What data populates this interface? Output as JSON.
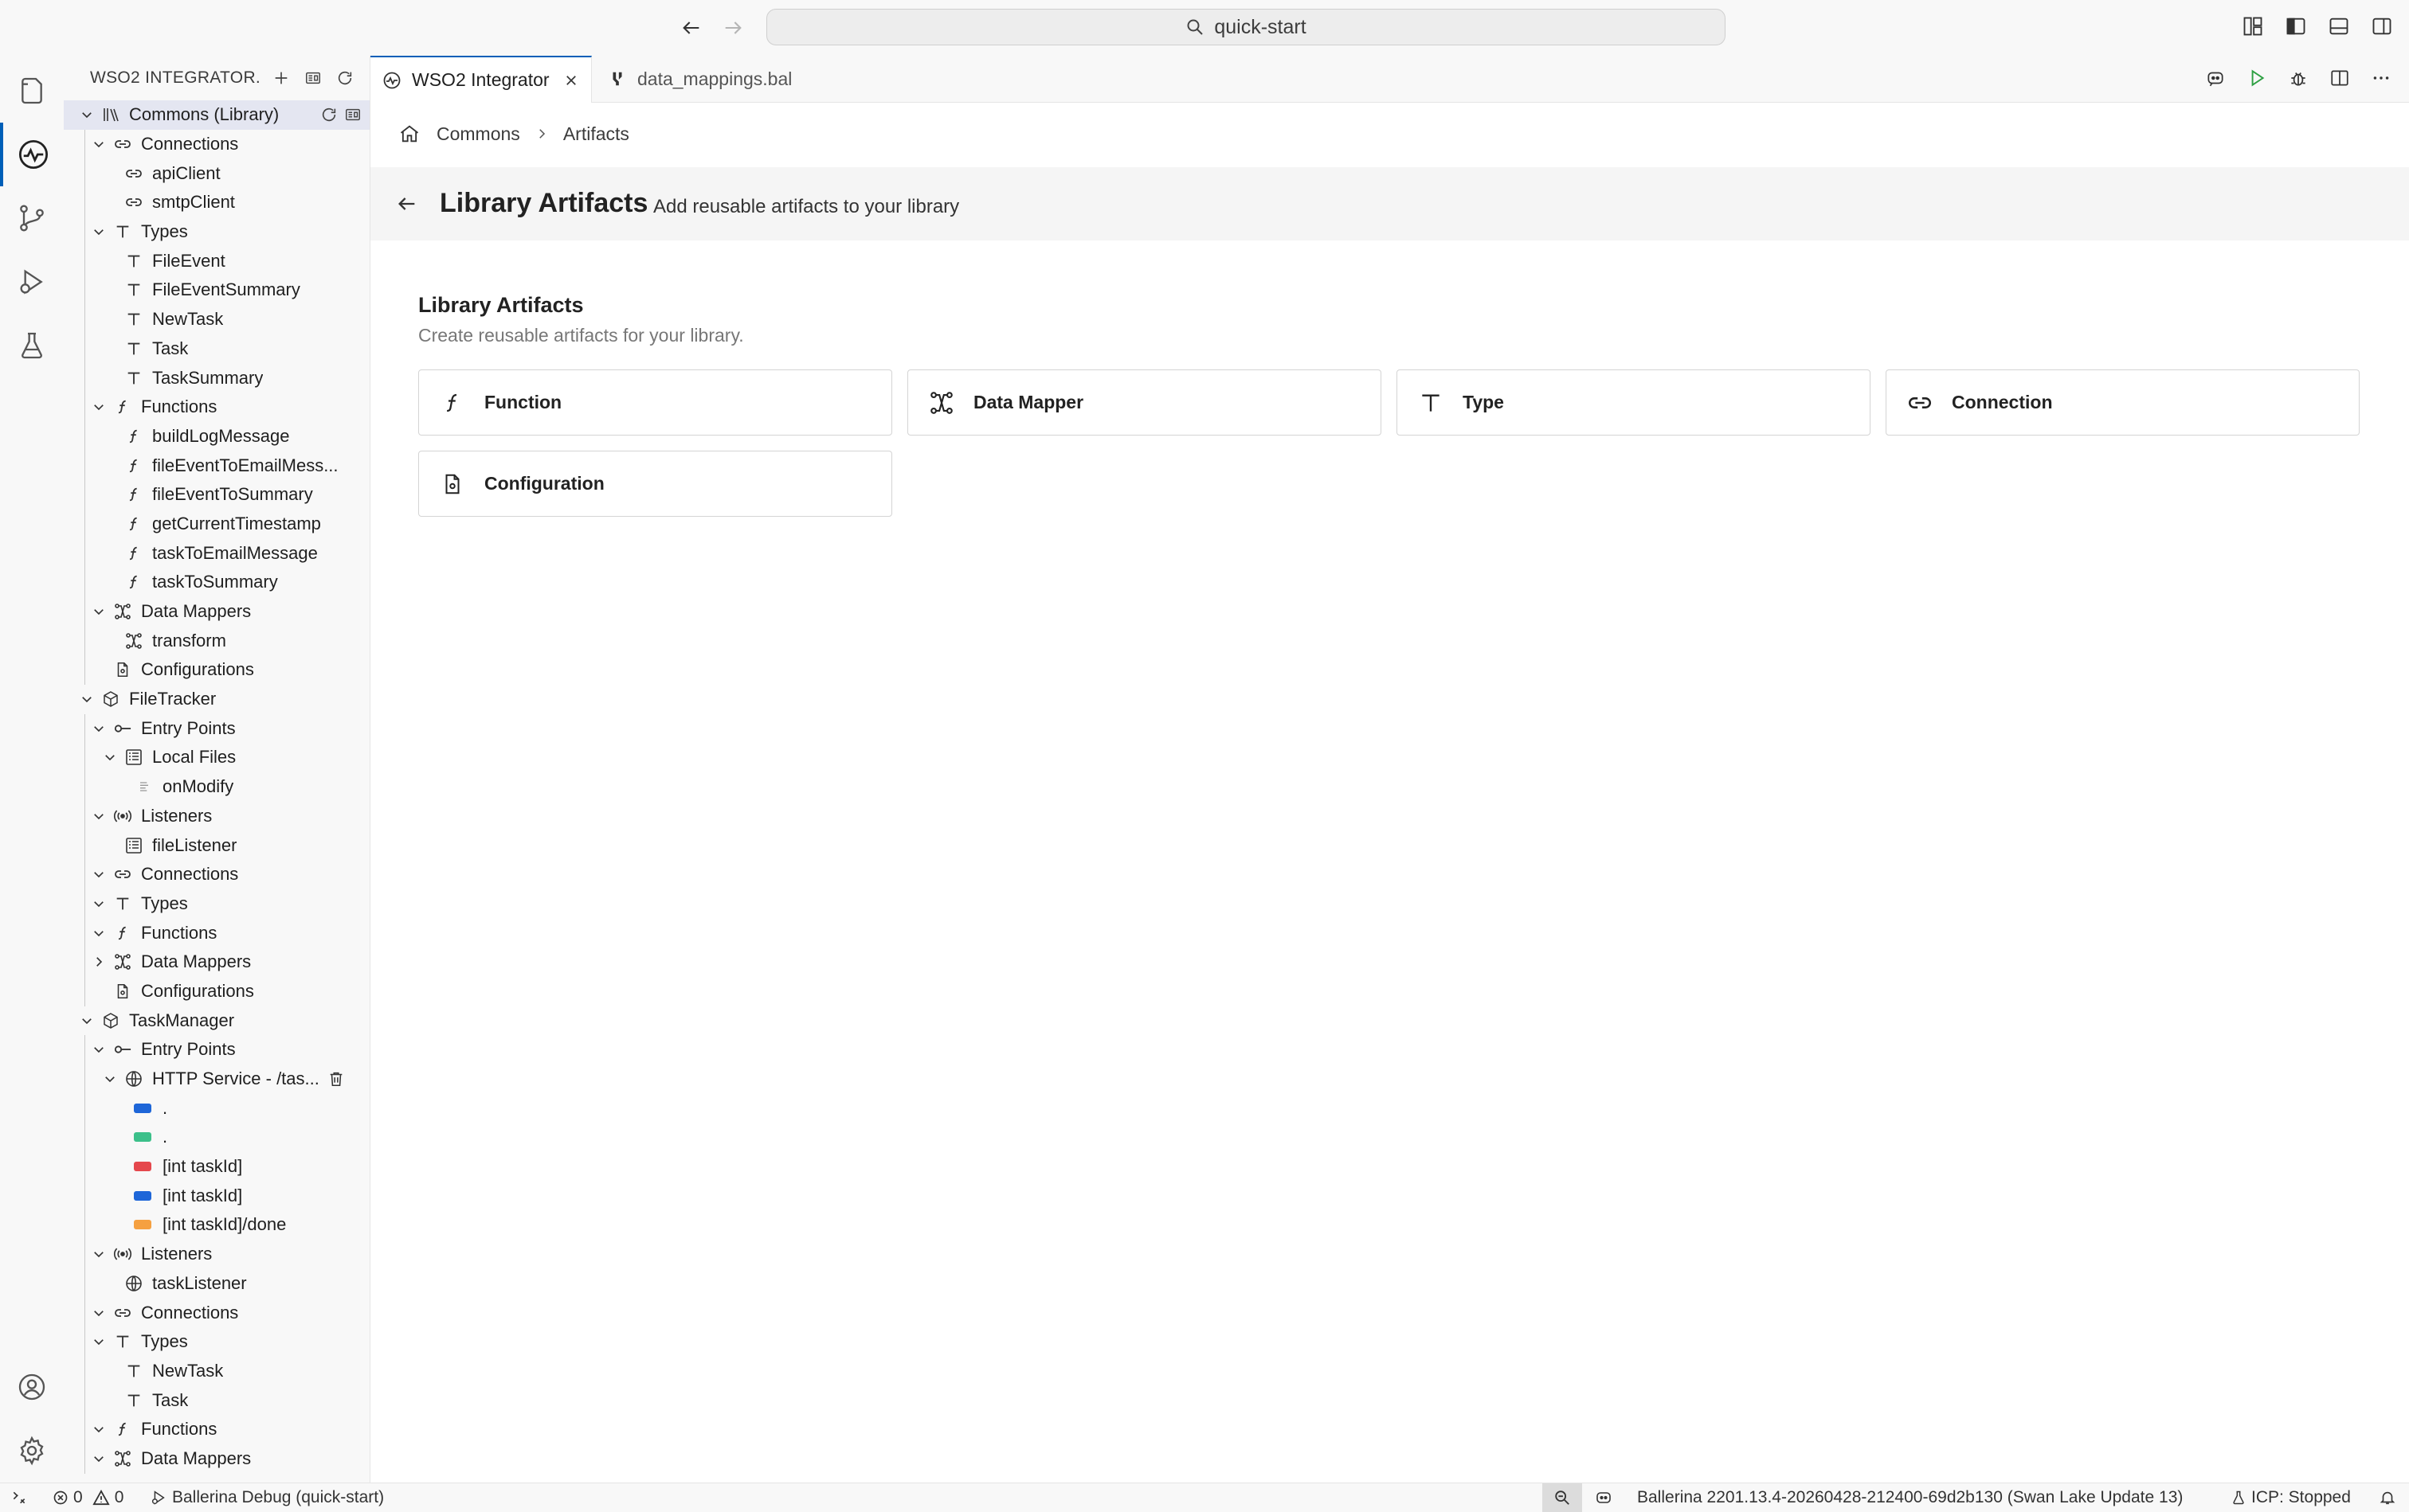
{
  "titlebar": {
    "search_text": "quick-start"
  },
  "sidebar": {
    "title": "WSO2 INTEGRATOR...",
    "tree": [
      {
        "label": "Commons (Library)",
        "level": 0,
        "chev": "down",
        "icon": "library",
        "sel": true
      },
      {
        "label": "Connections",
        "level": 1,
        "chev": "down",
        "icon": "link"
      },
      {
        "label": "apiClient",
        "level": 2,
        "icon": "link"
      },
      {
        "label": "smtpClient",
        "level": 2,
        "icon": "link"
      },
      {
        "label": "Types",
        "level": 1,
        "chev": "down",
        "icon": "type"
      },
      {
        "label": "FileEvent",
        "level": 2,
        "icon": "type"
      },
      {
        "label": "FileEventSummary",
        "level": 2,
        "icon": "type"
      },
      {
        "label": "NewTask",
        "level": 2,
        "icon": "type"
      },
      {
        "label": "Task",
        "level": 2,
        "icon": "type"
      },
      {
        "label": "TaskSummary",
        "level": 2,
        "icon": "type"
      },
      {
        "label": "Functions",
        "level": 1,
        "chev": "down",
        "icon": "function"
      },
      {
        "label": "buildLogMessage",
        "level": 2,
        "icon": "function"
      },
      {
        "label": "fileEventToEmailMess...",
        "level": 2,
        "icon": "function"
      },
      {
        "label": "fileEventToSummary",
        "level": 2,
        "icon": "function"
      },
      {
        "label": "getCurrentTimestamp",
        "level": 2,
        "icon": "function"
      },
      {
        "label": "taskToEmailMessage",
        "level": 2,
        "icon": "function"
      },
      {
        "label": "taskToSummary",
        "level": 2,
        "icon": "function"
      },
      {
        "label": "Data Mappers",
        "level": 1,
        "chev": "down",
        "icon": "mapper"
      },
      {
        "label": "transform",
        "level": 2,
        "icon": "mapper"
      },
      {
        "label": "Configurations",
        "level": 1,
        "chev": "none",
        "icon": "config"
      },
      {
        "label": "FileTracker",
        "level": 0,
        "chev": "down",
        "icon": "package"
      },
      {
        "label": "Entry Points",
        "level": 1,
        "chev": "down",
        "icon": "entry"
      },
      {
        "label": "Local Files",
        "level": 2,
        "chev": "down",
        "icon": "listener-box"
      },
      {
        "label": "onModify",
        "level": 3,
        "icon": "doc"
      },
      {
        "label": "Listeners",
        "level": 1,
        "chev": "down",
        "icon": "radio"
      },
      {
        "label": "fileListener",
        "level": 2,
        "icon": "listener-box"
      },
      {
        "label": "Connections",
        "level": 1,
        "chev": "down",
        "icon": "link"
      },
      {
        "label": "Types",
        "level": 1,
        "chev": "down",
        "icon": "type"
      },
      {
        "label": "Functions",
        "level": 1,
        "chev": "down",
        "icon": "function"
      },
      {
        "label": "Data Mappers",
        "level": 1,
        "chev": "right",
        "icon": "mapper"
      },
      {
        "label": "Configurations",
        "level": 1,
        "chev": "none",
        "icon": "config"
      },
      {
        "label": "TaskManager",
        "level": 0,
        "chev": "down",
        "icon": "package"
      },
      {
        "label": "Entry Points",
        "level": 1,
        "chev": "down",
        "icon": "entry"
      },
      {
        "label": "HTTP Service - /tas...",
        "level": 2,
        "chev": "down",
        "icon": "globe",
        "trash": true
      },
      {
        "label": ".",
        "level": 3,
        "method": "#1e66d8"
      },
      {
        "label": ".",
        "level": 3,
        "method": "#3cc08a"
      },
      {
        "label": "[int taskId]",
        "level": 3,
        "method": "#e5484d"
      },
      {
        "label": "[int taskId]",
        "level": 3,
        "method": "#1e66d8"
      },
      {
        "label": "[int taskId]/done",
        "level": 3,
        "method": "#f5a040"
      },
      {
        "label": "Listeners",
        "level": 1,
        "chev": "down",
        "icon": "radio"
      },
      {
        "label": "taskListener",
        "level": 2,
        "icon": "globe"
      },
      {
        "label": "Connections",
        "level": 1,
        "chev": "down",
        "icon": "link"
      },
      {
        "label": "Types",
        "level": 1,
        "chev": "down",
        "icon": "type"
      },
      {
        "label": "NewTask",
        "level": 2,
        "icon": "type"
      },
      {
        "label": "Task",
        "level": 2,
        "icon": "type"
      },
      {
        "label": "Functions",
        "level": 1,
        "chev": "down",
        "icon": "function"
      },
      {
        "label": "Data Mappers",
        "level": 1,
        "chev": "down",
        "icon": "mapper"
      }
    ]
  },
  "tabs": [
    {
      "label": "WSO2 Integrator",
      "active": true
    },
    {
      "label": "data_mappings.bal",
      "active": false
    }
  ],
  "breadcrumb": {
    "item1": "Commons",
    "item2": "Artifacts"
  },
  "page": {
    "title": "Library Artifacts",
    "subtitle": "Add reusable artifacts to your library"
  },
  "section": {
    "title": "Library Artifacts",
    "subtitle": "Create reusable artifacts for your library."
  },
  "cards": [
    {
      "label": "Function",
      "icon": "function"
    },
    {
      "label": "Data Mapper",
      "icon": "mapper"
    },
    {
      "label": "Type",
      "icon": "type"
    },
    {
      "label": "Connection",
      "icon": "link"
    },
    {
      "label": "Configuration",
      "icon": "config"
    }
  ],
  "statusbar": {
    "errors": "0",
    "warnings": "0",
    "debug": "Ballerina Debug (quick-start)",
    "version": "Ballerina 2201.13.4-20260428-212400-69d2b130 (Swan Lake Update 13)",
    "icp": "ICP: Stopped"
  },
  "colors": {
    "accent": "#005fb8",
    "selection": "#e4e6f1",
    "run": "#2ea043"
  }
}
